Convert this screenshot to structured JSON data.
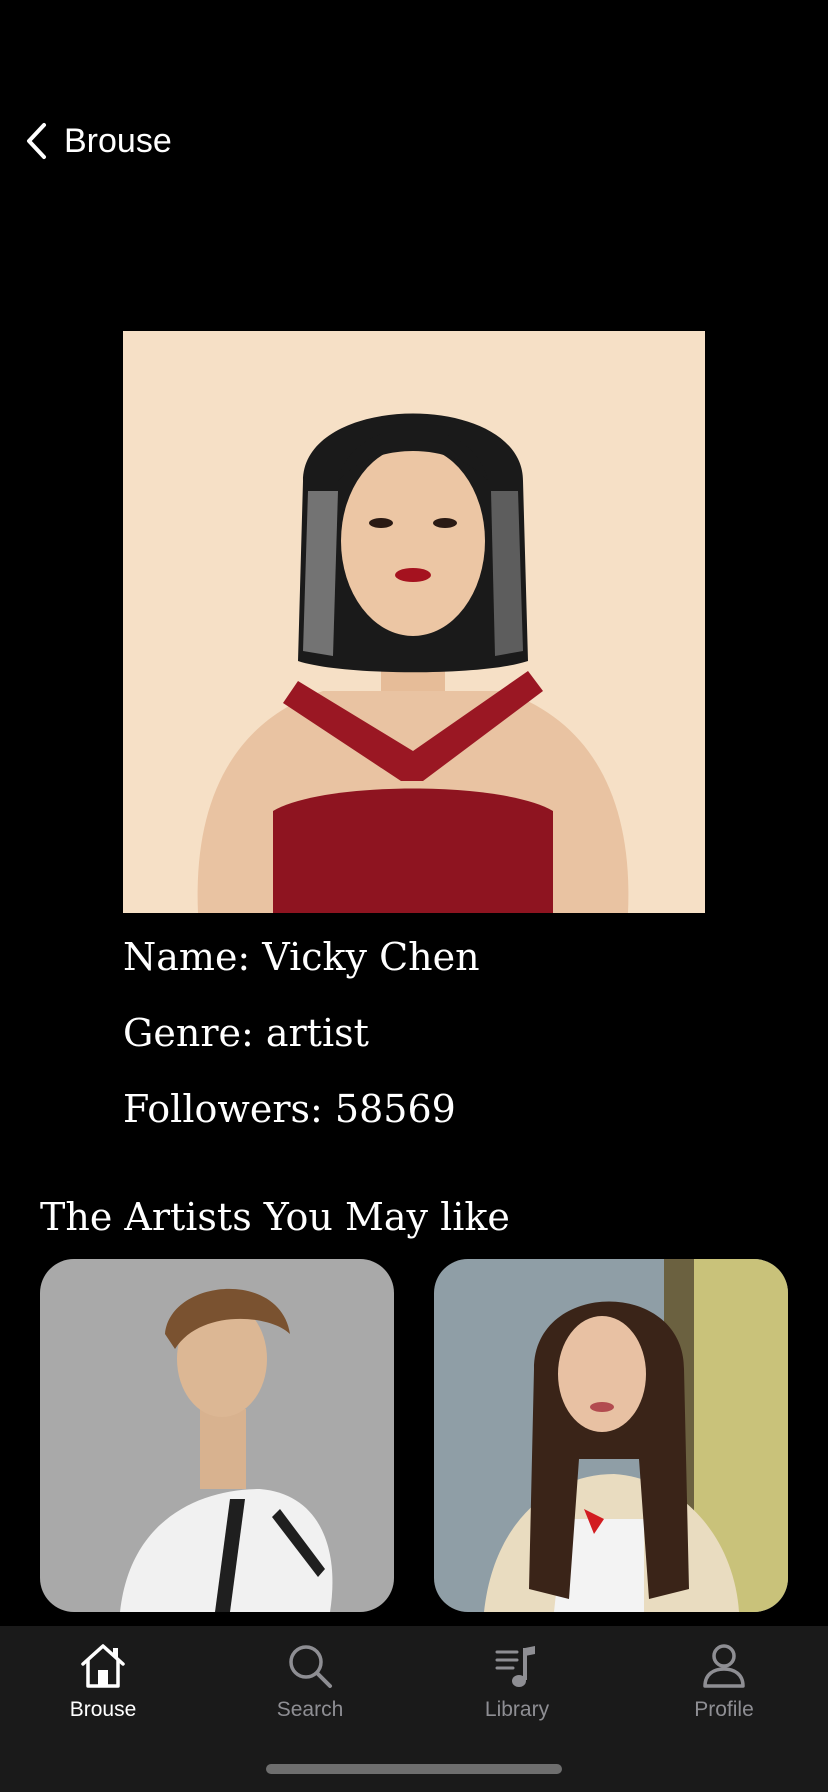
{
  "header": {
    "back_label": "Brouse"
  },
  "artist": {
    "name_line": "Name: Vicky Chen",
    "genre_line": "Genre: artist",
    "followers_line": "Followers: 58569"
  },
  "recommendations": {
    "title": "The Artists You May like",
    "cards": [
      {
        "icon": "artist-photo-male"
      },
      {
        "icon": "artist-photo-female"
      }
    ]
  },
  "tabbar": {
    "tabs": [
      {
        "label": "Brouse",
        "icon": "home-icon",
        "active": true
      },
      {
        "label": "Search",
        "icon": "search-icon",
        "active": false
      },
      {
        "label": "Library",
        "icon": "music-library-icon",
        "active": false
      },
      {
        "label": "Profile",
        "icon": "person-icon",
        "active": false
      }
    ]
  },
  "colors": {
    "background": "#000000",
    "tabbar_bg": "#1a1a1a",
    "tab_inactive": "#8e8e93",
    "tab_active": "#ffffff"
  }
}
